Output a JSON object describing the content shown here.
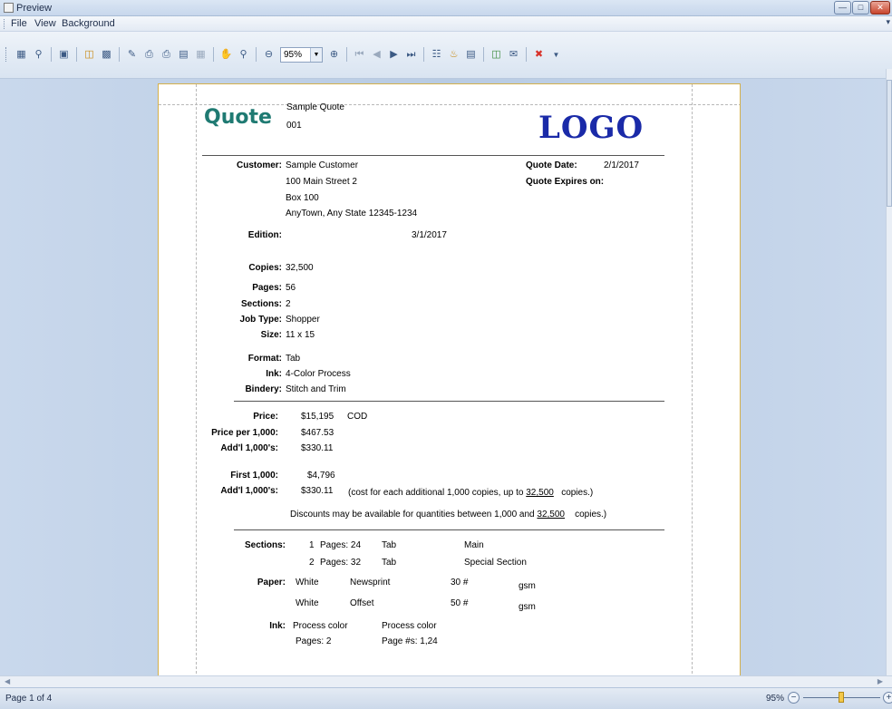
{
  "window": {
    "title": "Preview"
  },
  "menu": {
    "items": [
      "File",
      "View",
      "Background"
    ]
  },
  "toolbar": {
    "zoom_value": "95%"
  },
  "report": {
    "heading": "Quote",
    "subtitle": "Sample Quote",
    "number": "001",
    "logo": "LOGO",
    "customer_label": "Customer:",
    "customer_lines": [
      "Sample Customer",
      "100 Main Street 2",
      "Box 100",
      "AnyTown, Any State  12345-1234"
    ],
    "quote_date_label": "Quote Date:",
    "quote_date": "2/1/2017",
    "expires_label": "Quote Expires on:",
    "edition_label": "Edition:",
    "edition": "3/1/2017",
    "copies_label": "Copies:",
    "copies": "32,500",
    "pages_label": "Pages:",
    "pages": "56",
    "sections_label": "Sections:",
    "sections": "2",
    "jobtype_label": "Job Type:",
    "jobtype": "Shopper",
    "size_label": "Size:",
    "size": "11 x 15",
    "format_label": "Format:",
    "format": "Tab",
    "ink_label": "Ink:",
    "ink": "4-Color Process",
    "bindery_label": "Bindery:",
    "bindery": "Stitch and Trim",
    "price_label": "Price:",
    "price": "$15,195",
    "price_terms": "COD",
    "ppt_label": "Price per 1,000:",
    "ppt": "$467.53",
    "addl_label": "Add'l 1,000's:",
    "addl": "$330.11",
    "first_label": "First 1,000:",
    "first": "$4,796",
    "addl2_label": "Add'l 1,000's:",
    "addl2": "$330.11",
    "addl2_note_pre": "(cost for each additional 1,000 copies, up to",
    "addl2_note_qty": "32,500",
    "addl2_note_post": "copies.)",
    "discount_pre": "Discounts may be available for quantities between 1,000 and",
    "discount_qty": "32,500",
    "discount_post": "copies.)",
    "sections2_label": "Sections:",
    "section_rows": [
      {
        "num": "1",
        "pages": "Pages: 24",
        "format": "Tab",
        "name": "Main"
      },
      {
        "num": "2",
        "pages": "Pages: 32",
        "format": "Tab",
        "name": "Special Section"
      }
    ],
    "paper_label": "Paper:",
    "paper_rows": [
      {
        "color": "White",
        "stock": "Newsprint",
        "weight": "30 #",
        "unit": "gsm"
      },
      {
        "color": "White",
        "stock": "Offset",
        "weight": "50 #",
        "unit": "gsm"
      }
    ],
    "ink2_label": "Ink:",
    "ink_front": "Process color",
    "ink_back": "Process color",
    "ink_pages": "Pages: 2",
    "ink_pagenums": "Page #s: 1,24"
  },
  "status": {
    "page": "Page 1 of 4",
    "zoom": "95%"
  }
}
